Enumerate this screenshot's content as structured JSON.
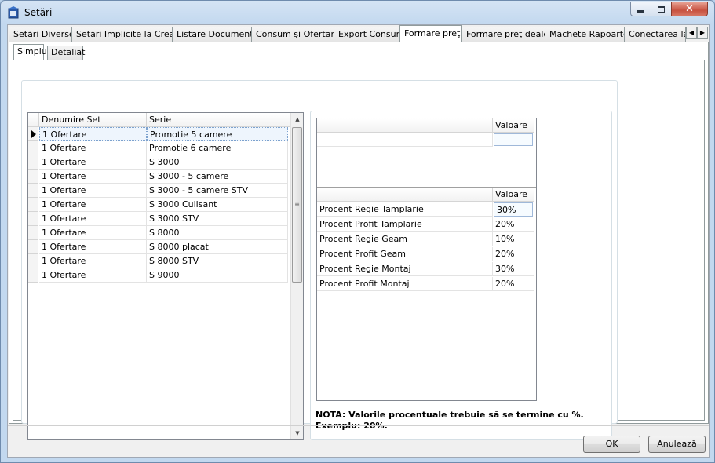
{
  "window": {
    "title": "Setări"
  },
  "tabs": [
    "Setări Diverse",
    "Setări Implicite la Creare",
    "Listare Documente",
    "Consum şi Ofertare",
    "Export Consum",
    "Formare preţ",
    "Formare preţ dealer",
    "Machete Rapoarte",
    "Conectarea la"
  ],
  "active_tab": "Formare preţ",
  "subtabs": [
    "Simplu",
    "Detaliat"
  ],
  "active_subtab": "Simplu",
  "sets_grid": {
    "headers": [
      "Denumire Set",
      "Serie"
    ],
    "rows": [
      [
        "1 Ofertare",
        "Promotie 5 camere"
      ],
      [
        "1 Ofertare",
        "Promotie 6 camere"
      ],
      [
        "1 Ofertare",
        "S 3000"
      ],
      [
        "1 Ofertare",
        "S 3000 - 5 camere"
      ],
      [
        "1 Ofertare",
        "S 3000 - 5 camere STV"
      ],
      [
        "1 Ofertare",
        "S 3000 Culisant"
      ],
      [
        "1 Ofertare",
        "S 3000 STV"
      ],
      [
        "1 Ofertare",
        "S 8000"
      ],
      [
        "1 Ofertare",
        "S 8000 placat"
      ],
      [
        "1 Ofertare",
        "S 8000 STV"
      ],
      [
        "1 Ofertare",
        "S 9000"
      ]
    ],
    "selected_row": 0
  },
  "value_grid_top": {
    "header": "Valoare",
    "value": ""
  },
  "value_grid_bottom": {
    "header": "Valoare",
    "rows": [
      [
        "Procent Regie Tamplarie",
        "30%"
      ],
      [
        "Procent Profit Tamplarie",
        "20%"
      ],
      [
        "Procent Regie Geam",
        "10%"
      ],
      [
        "Procent Profit Geam",
        "20%"
      ],
      [
        "Procent Regie Montaj",
        "30%"
      ],
      [
        "Procent Profit Montaj",
        "20%"
      ]
    ]
  },
  "note": "NOTA: Valorile procentuale trebuie să se termine cu %. Exemplu: 20%.",
  "buttons": {
    "ok": "OK",
    "cancel": "Anulează"
  },
  "icons": {
    "app": "app-icon",
    "minimize": "minimize-icon",
    "maximize": "maximize-icon",
    "close": "close-icon"
  }
}
